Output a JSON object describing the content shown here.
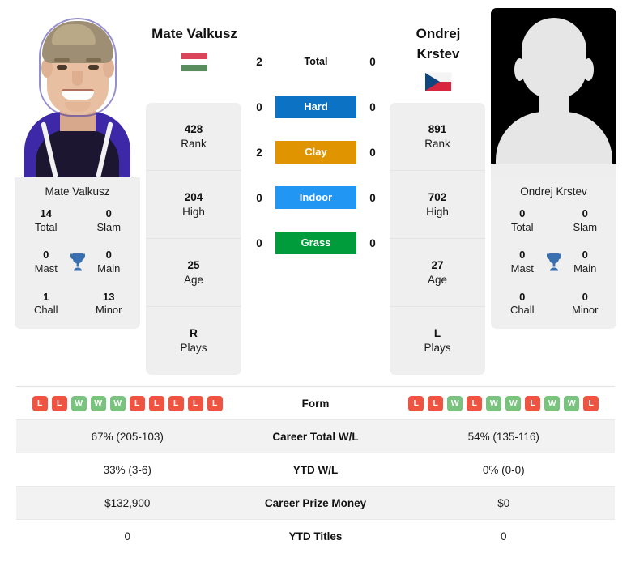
{
  "players": {
    "left": {
      "name": "Mate Valkusz",
      "card_name": "Mate Valkusz",
      "flag": "hungary-flag",
      "photo": "player-photo",
      "titles": {
        "total": "14",
        "slam": "0",
        "mast": "0",
        "main": "0",
        "chall": "1",
        "minor": "13"
      },
      "ranking": {
        "rank": "428",
        "high": "204",
        "age": "25",
        "plays": "R"
      },
      "form": [
        "L",
        "L",
        "W",
        "W",
        "W",
        "L",
        "L",
        "L",
        "L",
        "L"
      ],
      "career_total_wl": "67% (205-103)",
      "ytd_wl": "33% (3-6)",
      "career_prize_money": "$132,900",
      "ytd_titles": "0"
    },
    "right": {
      "name_line1": "Ondrej",
      "name_line2": "Krstev",
      "card_name": "Ondrej Krstev",
      "flag": "czech-republic-flag",
      "photo": "player-photo-placeholder",
      "titles": {
        "total": "0",
        "slam": "0",
        "mast": "0",
        "main": "0",
        "chall": "0",
        "minor": "0"
      },
      "ranking": {
        "rank": "891",
        "high": "702",
        "age": "27",
        "plays": "L"
      },
      "form": [
        "L",
        "L",
        "W",
        "L",
        "W",
        "W",
        "L",
        "W",
        "W",
        "L"
      ],
      "career_total_wl": "54% (135-116)",
      "ytd_wl": "0% (0-0)",
      "career_prize_money": "$0",
      "ytd_titles": "0"
    }
  },
  "titles_labels": {
    "total": "Total",
    "slam": "Slam",
    "mast": "Mast",
    "main": "Main",
    "chall": "Chall",
    "minor": "Minor"
  },
  "ranking_labels": {
    "rank": "Rank",
    "high": "High",
    "age": "Age",
    "plays": "Plays"
  },
  "h2h": {
    "rows": [
      {
        "surface": "Total",
        "left": "2",
        "right": "0",
        "color": ""
      },
      {
        "surface": "Hard",
        "left": "0",
        "right": "0",
        "color": "#0b72c4"
      },
      {
        "surface": "Clay",
        "left": "2",
        "right": "0",
        "color": "#e09400"
      },
      {
        "surface": "Indoor",
        "left": "0",
        "right": "0",
        "color": "#2196f3"
      },
      {
        "surface": "Grass",
        "left": "0",
        "right": "0",
        "color": "#009b3a"
      }
    ]
  },
  "stats_table": {
    "rows": [
      {
        "label": "Form",
        "type": "form"
      },
      {
        "label": "Career Total W/L",
        "type": "text",
        "left": "67% (205-103)",
        "right": "54% (135-116)"
      },
      {
        "label": "YTD W/L",
        "type": "text",
        "left": "33% (3-6)",
        "right": "0% (0-0)"
      },
      {
        "label": "Career Prize Money",
        "type": "text",
        "left": "$132,900",
        "right": "$0"
      },
      {
        "label": "YTD Titles",
        "type": "text",
        "left": "0",
        "right": "0"
      }
    ]
  },
  "colors": {
    "hard": "#0b72c4",
    "clay": "#e09400",
    "indoor": "#2196f3",
    "grass": "#009b3a",
    "win": "#79c37f",
    "loss": "#ef5443",
    "trophy": "#3a6fb0"
  }
}
